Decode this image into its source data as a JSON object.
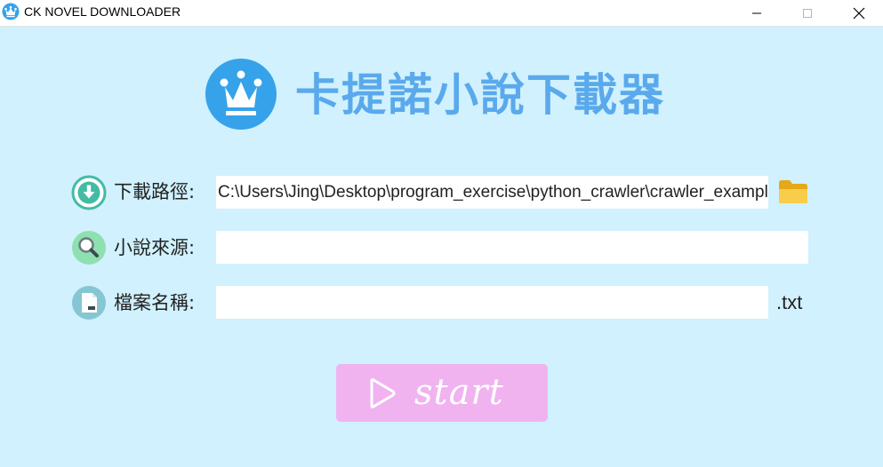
{
  "window": {
    "title": "CK NOVEL DOWNLOADER"
  },
  "header": {
    "title": "卡提諾小說下載器"
  },
  "form": {
    "path": {
      "label": "下載路徑:",
      "value": "C:\\Users\\Jing\\Desktop\\program_exercise\\python_crawler\\crawler_example"
    },
    "source": {
      "label": "小說來源:",
      "value": ""
    },
    "filename": {
      "label": "檔案名稱:",
      "value": "",
      "extension": ".txt"
    }
  },
  "start_button": {
    "label": "start"
  },
  "icons": {
    "app": "crown-icon",
    "path": "download-icon",
    "source": "search-icon",
    "filename": "file-icon",
    "browse": "folder-icon",
    "start": "play-icon"
  },
  "colors": {
    "background": "#d0f1fd",
    "title": "#5aa9ec",
    "logo": "#36a2ea",
    "start_button": "#f0b3f0",
    "download_icon": "#44bba4",
    "search_icon": "#8fe0b0",
    "file_icon": "#86c6d4",
    "folder": "#f5c542"
  }
}
